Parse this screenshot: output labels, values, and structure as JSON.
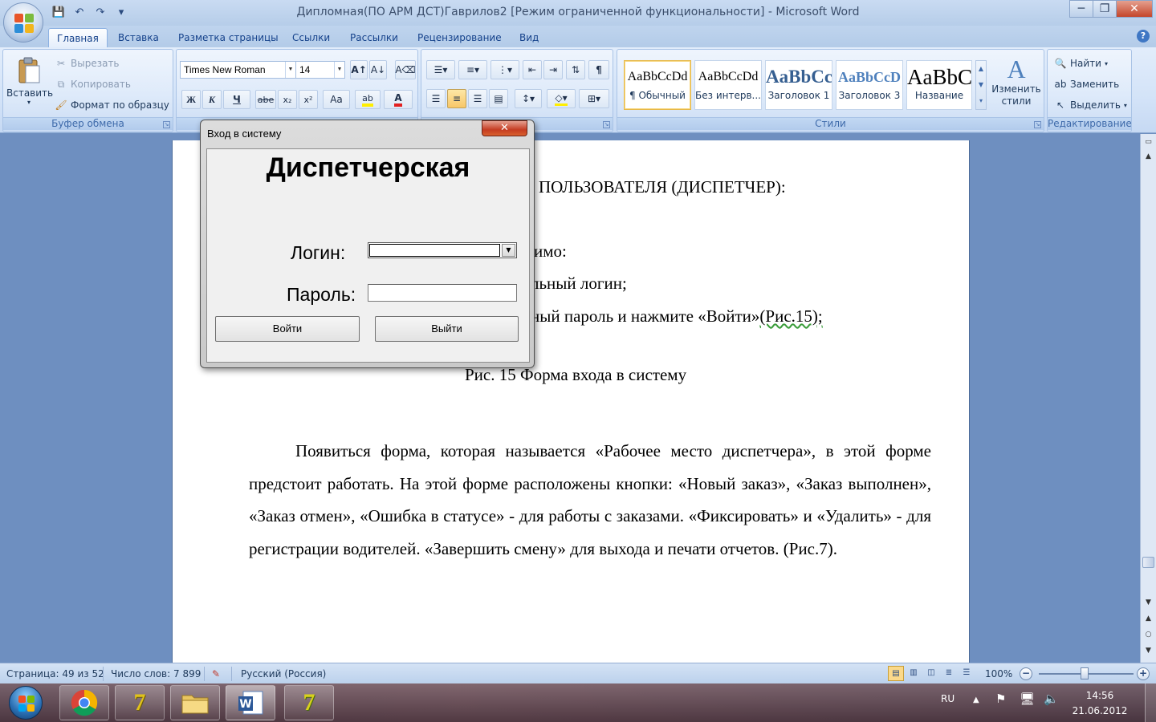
{
  "window": {
    "title": "Дипломная(ПО АРМ ДСТ)Гаврилов2 [Режим ограниченной функциональности]  -  Microsoft Word",
    "controls": {
      "minimize": "─",
      "maximize": "❐",
      "close": "✕"
    }
  },
  "qat": {
    "save_icon": "💾",
    "undo_icon": "↶",
    "redo_icon": "↷",
    "more_icon": "▾"
  },
  "tabs": [
    {
      "label": "Главная"
    },
    {
      "label": "Вставка"
    },
    {
      "label": "Разметка страницы"
    },
    {
      "label": "Ссылки"
    },
    {
      "label": "Рассылки"
    },
    {
      "label": "Рецензирование"
    },
    {
      "label": "Вид"
    }
  ],
  "ribbon": {
    "clipboard": {
      "label": "Буфер обмена",
      "paste": "Вставить",
      "cut": "Вырезать",
      "copy": "Копировать",
      "format_painter": "Формат по образцу"
    },
    "font": {
      "family": "Times New Roman",
      "size": "14",
      "bold": "Ж",
      "italic": "К",
      "underline": "Ч",
      "strike": "abe",
      "subscript": "x₂",
      "superscript": "x²",
      "case": "Aa",
      "grow": "A↑",
      "shrink": "A↓",
      "clear": "A⌫",
      "font_color_letter": "A"
    },
    "paragraph": {
      "pilcrow": "¶"
    },
    "styles": {
      "label": "Стили",
      "items": [
        {
          "sample": "AaBbCcDd",
          "name": "¶ Обычный",
          "color": "#000000"
        },
        {
          "sample": "AaBbCcDd",
          "name": "Без интерв...",
          "color": "#000000"
        },
        {
          "sample": "AaBbCc",
          "name": "Заголовок 1",
          "color": "#365f91"
        },
        {
          "sample": "AaBbCcD",
          "name": "Заголовок 3",
          "color": "#4f81bd"
        },
        {
          "sample": "AaBbC",
          "name": "Название",
          "color": "#000000"
        }
      ],
      "change_styles": "Изменить стили"
    },
    "editing": {
      "label": "Редактирование",
      "find": "Найти",
      "replace": "Заменить",
      "select": "Выделить"
    }
  },
  "document": {
    "heading_fragment": "ПОЛЬЗОВАТЕЛЯ (ДИСПЕТЧЕР):",
    "line1": "имо:",
    "line2": "льный логин;",
    "line3_before": "ный пароль и нажмите «Войти»",
    "line3_after": "(Рис.15);",
    "caption": "Рис. 15 Форма входа в систему",
    "paragraph": "Появиться форма, которая называется «Рабочее место диспетчера», в этой форме предстоит работать. На этой форме расположены кнопки: «Новый заказ», «Заказ выполнен», «Заказ отмен», «Ошибка в статусе» - для работы с заказами. «Фиксировать» и «Удалить» - для регистрации водителей. «Завершить смену» для выхода и печати отчетов. (Рис.7)."
  },
  "dialog": {
    "title": "Вход в систему",
    "close": "✕",
    "heading": "Диспетчерская",
    "login_label": "Логин:",
    "login_value": "",
    "password_label": "Пароль:",
    "password_value": "",
    "login_button": "Войти",
    "exit_button": "Выйти"
  },
  "statusbar": {
    "page": "Страница: 49 из 52",
    "words": "Число слов: 7 899",
    "language": "Русский (Россия)",
    "zoom": "100%",
    "zoom_minus": "−",
    "zoom_plus": "+"
  },
  "taskbar": {
    "language": "RU",
    "time": "14:56",
    "date": "21.06.2012",
    "apps": [
      "chrome-icon",
      "app-7-icon",
      "folder-icon",
      "word-icon",
      "app-7z-icon"
    ]
  },
  "colors": {
    "ribbon_bg": "#d3e3f8",
    "accent_blue": "#15428b",
    "close_red": "#c53c22",
    "selected_yellow": "#f8c768"
  }
}
